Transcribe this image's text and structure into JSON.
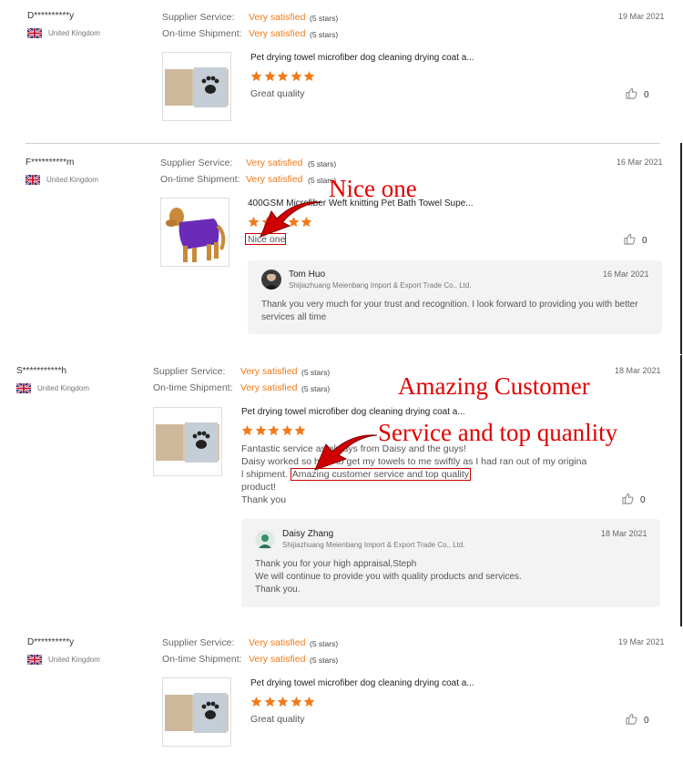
{
  "reviews": [
    {
      "buyer": "D**********y",
      "country": "United Kingdom",
      "supplier_label": "Supplier Service:",
      "supplier_value": "Very satisfied",
      "supplier_stars": "(5 stars)",
      "shipment_label": "On-time Shipment:",
      "shipment_value": "Very satisfied",
      "shipment_stars": "(5 stars)",
      "date": "19 Mar 2021",
      "product_title": "Pet drying towel microfiber dog cleaning drying coat a...",
      "rating": 5,
      "comment": "Great quality",
      "likes": "0"
    },
    {
      "buyer": "F**********m",
      "country": "United Kingdom",
      "supplier_label": "Supplier Service:",
      "supplier_value": "Very satisfied",
      "supplier_stars": "(5 stars)",
      "shipment_label": "On-time Shipment:",
      "shipment_value": "Very satisfied",
      "shipment_stars": "(5 stars)",
      "date": "16 Mar 2021",
      "product_title": "400GSM Microfiber Weft knitting Pet Bath Towel Supe...",
      "rating": 5,
      "comment": "Nice one",
      "likes": "0",
      "reply": {
        "name": "Tom Huo",
        "company": "Shijiazhuang Meienbang Import & Export Trade Co., Ltd.",
        "date": "16 Mar 2021",
        "text": "Thank you very much for your trust and recognition. I look forward to providing you with better services all time"
      }
    },
    {
      "buyer": "S***********h",
      "country": "United Kingdom",
      "supplier_label": "Supplier Service:",
      "supplier_value": "Very satisfied",
      "supplier_stars": "(5 stars)",
      "shipment_label": "On-time Shipment:",
      "shipment_value": "Very satisfied",
      "shipment_stars": "(5 stars)",
      "date": "18 Mar 2021",
      "product_title": "Pet drying towel microfiber dog cleaning drying coat a...",
      "rating": 5,
      "comment_lines": [
        "Fantastic service as always from Daisy and the guys!",
        "Daisy worked so hard to get my towels to me swiftly as I had ran out of my origina",
        "l shipment.",
        "Amazing customer service and top quality",
        "product!",
        "Thank you"
      ],
      "likes": "0",
      "reply": {
        "name": "Daisy Zhang",
        "company": "Shijiazhuang Meienbang Import & Export Trade Co., Ltd.",
        "date": "18 Mar 2021",
        "lines": [
          "Thank you for your high appraisal,Steph",
          "We will continue to provide you with quality products and services.",
          "Thank you."
        ]
      }
    },
    {
      "buyer": "D**********y",
      "country": "United Kingdom",
      "supplier_label": "Supplier Service:",
      "supplier_value": "Very satisfied",
      "supplier_stars": "(5 stars)",
      "shipment_label": "On-time Shipment:",
      "shipment_value": "Very satisfied",
      "shipment_stars": "(5 stars)",
      "date": "19 Mar 2021",
      "product_title": "Pet drying towel microfiber dog cleaning drying coat a...",
      "rating": 5,
      "comment": "Great quality",
      "likes": "0"
    }
  ],
  "annotations": {
    "nice_one": "Nice one",
    "amazing_line1": "Amazing Customer",
    "amazing_line2": "Service and top quanlity"
  },
  "colors": {
    "accent": "#f27a1a",
    "annotation": "#e00000"
  },
  "icons": [
    "uk-flag-icon",
    "star-icon",
    "thumbs-up-icon",
    "arrow-icon"
  ]
}
